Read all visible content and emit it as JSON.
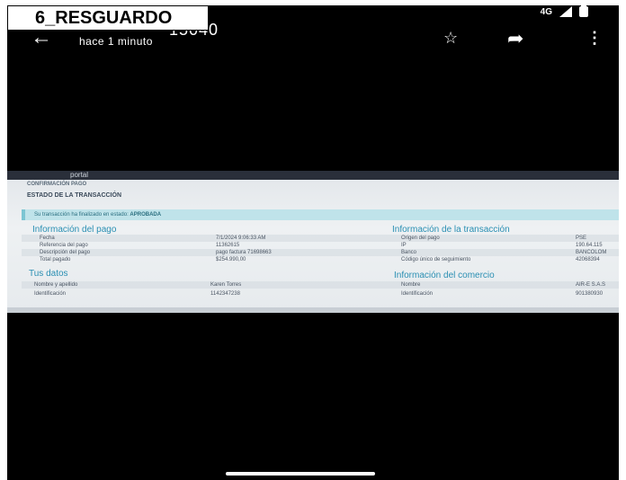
{
  "label": "6_RESGUARDO",
  "status_bar": {
    "network": "4G"
  },
  "app_bar": {
    "back_icon": "arrow-left-icon",
    "title": "15040",
    "subtitle": "hace 1 minuto",
    "star_icon": "star-icon",
    "share_icon": "share-arrow-icon",
    "menu_icon": "kebab-menu-icon"
  },
  "photo": {
    "portal_name": "portal",
    "breadcrumb": "CONFIRMACIÓN PAGO",
    "page_title": "ESTADO DE LA TRANSACCIÓN",
    "success_text": "Su transacción ha finalizado en estado:",
    "success_status": "APROBADA",
    "payment_info": {
      "title": "Información del pago",
      "rows": [
        {
          "label": "Fecha",
          "value": "7/1/2024 9:06:33 AM"
        },
        {
          "label": "Referencia del pago",
          "value": "11362615"
        },
        {
          "label": "Descripción del pago",
          "value": "pago factura 71698663"
        },
        {
          "label": "Total pagado",
          "value": "$254.990,00"
        }
      ]
    },
    "your_data": {
      "title": "Tus datos",
      "rows": [
        {
          "label": "Nombre y apellido",
          "value": "Karen Torres"
        },
        {
          "label": "Identificación",
          "value": "1142347238"
        }
      ]
    },
    "transaction_info": {
      "title": "Información de la transacción",
      "rows": [
        {
          "label": "Origen del pago",
          "value": "PSE"
        },
        {
          "label": "IP",
          "value": "190.64.115"
        },
        {
          "label": "Banco",
          "value": "BANCOLOM"
        },
        {
          "label": "Código único de seguimiento",
          "value": "42068394"
        }
      ]
    },
    "merchant_info": {
      "title": "Información del comercio",
      "rows": [
        {
          "label": "Nombre",
          "value": "AIR-E S.A.S"
        },
        {
          "label": "Identificación",
          "value": "901380930"
        }
      ]
    }
  }
}
